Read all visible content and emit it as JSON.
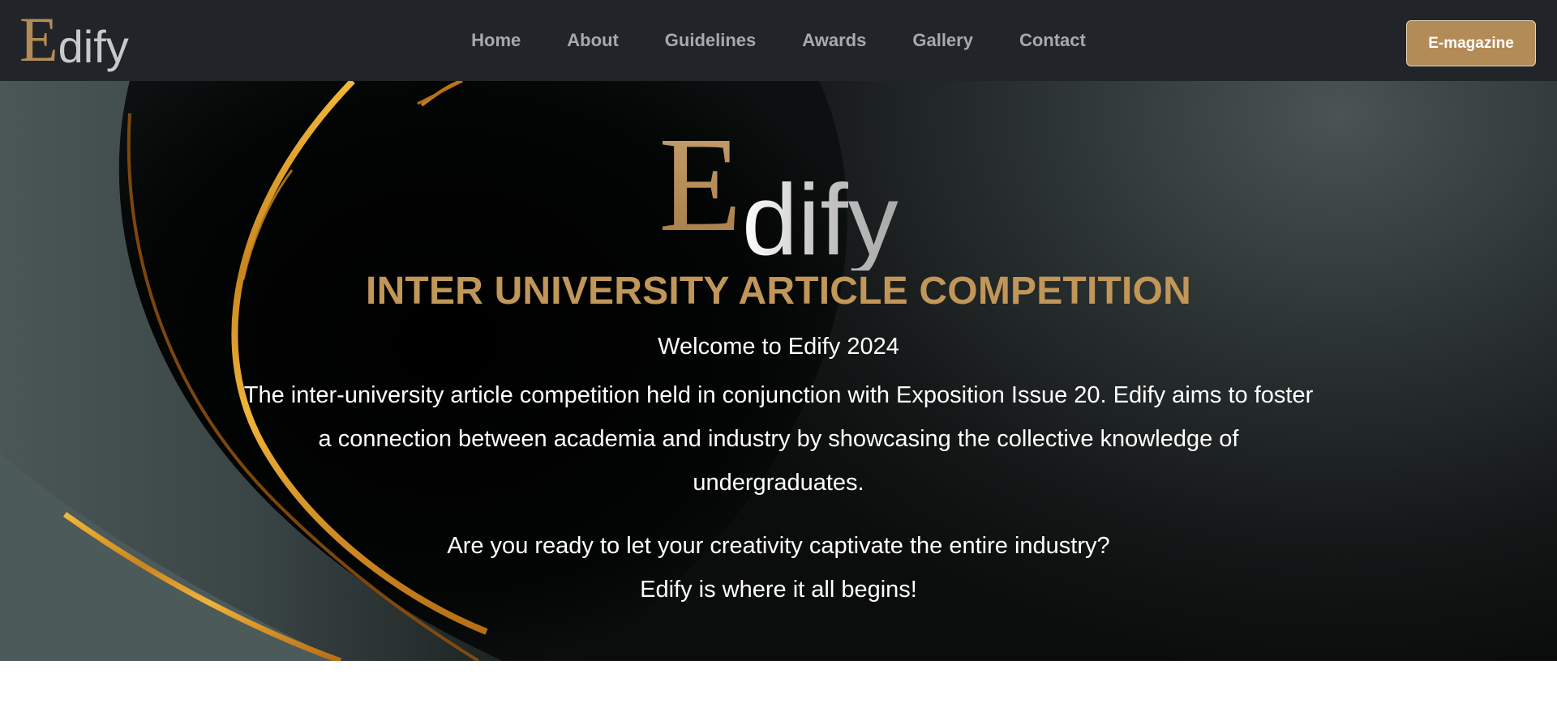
{
  "brand": {
    "logo_initial": "E",
    "logo_rest": "dify",
    "gold": "#b38b56",
    "dark": "#212529"
  },
  "nav": {
    "items": [
      {
        "label": "Home"
      },
      {
        "label": "About"
      },
      {
        "label": "Guidelines"
      },
      {
        "label": "Awards"
      },
      {
        "label": "Gallery"
      },
      {
        "label": "Contact"
      }
    ],
    "cta_label": "E-magazine"
  },
  "hero": {
    "logo_initial": "E",
    "logo_rest": "dify",
    "heading": "INTER UNIVERSITY ARTICLE COMPETITION",
    "welcome": "Welcome to Edify 2024",
    "description": "The inter-university article competition held in conjunction with Exposition Issue 20. Edify aims to foster a connection between academia and industry by showcasing the collective knowledge of undergraduates.",
    "question": "Are you ready to let your creativity captivate the entire industry?",
    "tagline": "Edify is where it all begins!"
  }
}
